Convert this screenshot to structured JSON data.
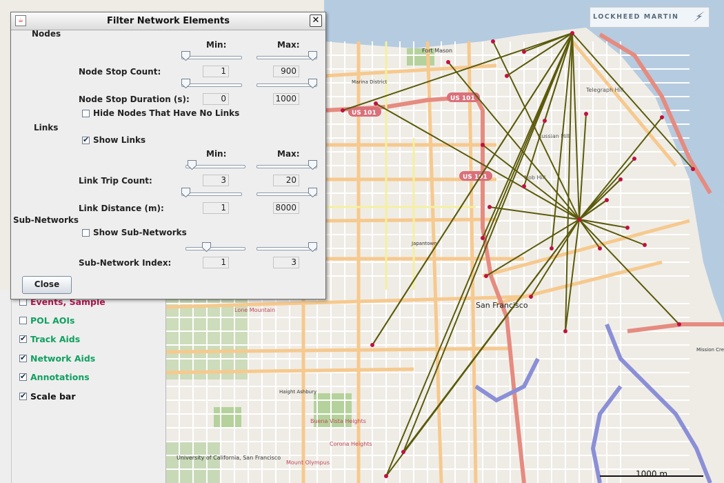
{
  "dialog": {
    "title": "Filter Network Elements",
    "nodes_heading": "Nodes",
    "links_heading": "Links",
    "subnet_heading": "Sub-Networks",
    "min_label": "Min:",
    "max_label": "Max:",
    "node_stop_count": {
      "label": "Node Stop Count:",
      "min": "1",
      "max": "900",
      "min_slider_fraction": 0.0,
      "max_slider_fraction": 1.0
    },
    "node_stop_duration": {
      "label": "Node Stop Duration (s):",
      "min": "0",
      "max": "1000",
      "min_slider_fraction": 0.0,
      "max_slider_fraction": 1.0
    },
    "hide_nodes": {
      "label": "Hide Nodes That Have No Links",
      "checked": false
    },
    "show_links": {
      "label": "Show Links",
      "checked": true
    },
    "link_trip_count": {
      "label": "Link Trip Count:",
      "min": "3",
      "max": "20",
      "min_slider_fraction": 0.05,
      "max_slider_fraction": 1.0
    },
    "link_distance": {
      "label": "Link Distance (m):",
      "min": "1",
      "max": "8000",
      "min_slider_fraction": 0.0,
      "max_slider_fraction": 1.0
    },
    "show_subnetworks": {
      "label": "Show Sub-Networks",
      "checked": false
    },
    "subnet_index": {
      "label": "Sub-Network Index:",
      "min": "1",
      "max": "3",
      "min_slider_fraction": 0.33,
      "max_slider_fraction": 1.0
    },
    "close_button": "Close"
  },
  "layers": [
    {
      "label": "Events, Sample",
      "checked": false,
      "color": "#b0164e"
    },
    {
      "label": "POL AOIs",
      "checked": false,
      "color": "#10a060"
    },
    {
      "label": "Track Aids",
      "checked": true,
      "color": "#10a060"
    },
    {
      "label": "Network Aids",
      "checked": true,
      "color": "#10a060"
    },
    {
      "label": "Annotations",
      "checked": true,
      "color": "#10a060"
    },
    {
      "label": "Scale bar",
      "checked": true,
      "color": "#111111"
    }
  ],
  "logo": "LOCKHEED MARTIN",
  "scale_label": "1000 m",
  "map_labels": {
    "marina": "Marina District",
    "russian_hill": "Russian Hill",
    "telegraph": "Telegraph Hill",
    "nob": "Nob Hill",
    "sf": "San Francisco",
    "haight": "Haight Ashbury",
    "buena": "Buena Vista Heights",
    "corona": "Corona Heights",
    "mission": "Mission Creek",
    "fort": "Fort Mason",
    "us101": "US 101",
    "lone": "Lone Mountain",
    "japantown": "Japantown",
    "twinpeaks": "Mount Olympus",
    "ucsf": "University of California, San Francisco"
  },
  "colors": {
    "link": "#5a5a0a",
    "node": "#c01040",
    "park": "#b5d29c",
    "major_road": "#f4c68c",
    "highway": "#e8877e"
  }
}
